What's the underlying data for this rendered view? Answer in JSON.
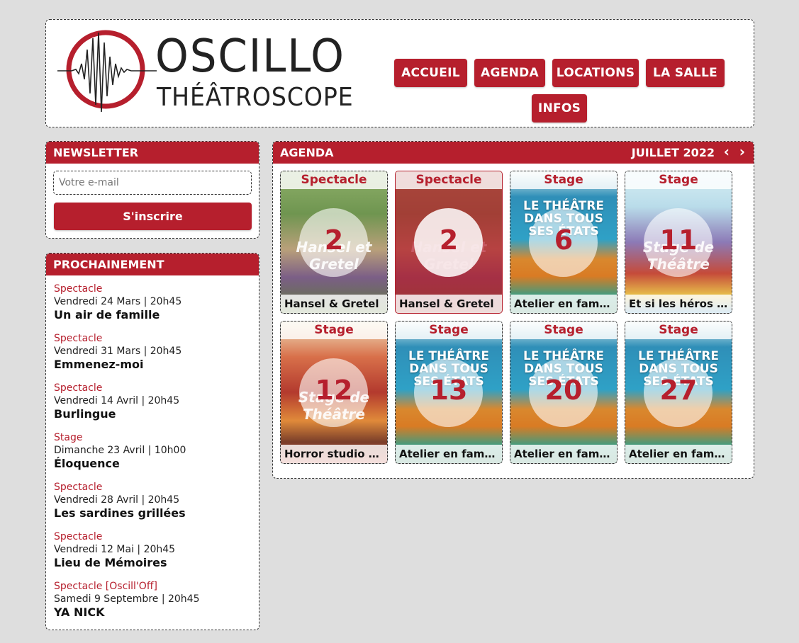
{
  "brand": {
    "line1": "OSCILLO",
    "line2": "THÉÂTROSCOPE"
  },
  "nav": [
    "ACCUEIL",
    "AGENDA",
    "LOCATIONS",
    "LA SALLE",
    "INFOS"
  ],
  "newsletter": {
    "heading": "NEWSLETTER",
    "email_placeholder": "Votre e-mail",
    "submit_label": "S'inscrire"
  },
  "upcoming": {
    "heading": "PROCHAINEMENT",
    "items": [
      {
        "type": "Spectacle",
        "date": "Vendredi 24 Mars | 20h45",
        "title": "Un air de famille"
      },
      {
        "type": "Spectacle",
        "date": "Vendredi 31 Mars | 20h45",
        "title": "Emmenez-moi"
      },
      {
        "type": "Spectacle",
        "date": "Vendredi 14 Avril | 20h45",
        "title": "Burlingue"
      },
      {
        "type": "Stage",
        "date": "Dimanche 23 Avril | 10h00",
        "title": "Éloquence"
      },
      {
        "type": "Spectacle",
        "date": "Vendredi 28 Avril | 20h45",
        "title": "Les sardines grillées"
      },
      {
        "type": "Spectacle",
        "date": "Vendredi 12 Mai | 20h45",
        "title": "Lieu de Mémoires"
      },
      {
        "type": "Spectacle [Oscill'Off]",
        "date": "Samedi 9 Septembre | 20h45",
        "title": "YA NICK"
      }
    ]
  },
  "agenda": {
    "heading": "AGENDA",
    "month": "JUILLET 2022",
    "prev_icon": "chevron-left-icon",
    "next_icon": "chevron-right-icon",
    "cards": [
      {
        "type": "Spectacle",
        "day": "2",
        "title": "Hansel & Gretel",
        "poster": "photo",
        "poster_text": [
          "Hansel et",
          "Gretel"
        ],
        "active": false
      },
      {
        "type": "Spectacle",
        "day": "2",
        "title": "Hansel & Gretel",
        "poster": "photo",
        "poster_text": [
          "Hansel et",
          "Gretel"
        ],
        "active": true
      },
      {
        "type": "Stage",
        "day": "6",
        "title": "Atelier en famille : Le théâtre dans tous ses états",
        "poster": "nature",
        "poster_text": [
          "LE THÉÂTRE",
          "DANS TOUS SES ÉTATS"
        ],
        "active": false
      },
      {
        "type": "Stage",
        "day": "11",
        "title": "Et si les héros des contes vivaient aujourd'hui ?",
        "poster": "illustration",
        "poster_text": [
          "Stage de",
          "Théâtre"
        ],
        "active": false
      },
      {
        "type": "Stage",
        "day": "12",
        "title": "Horror studio ! Mangas et autres animés",
        "poster": "manga",
        "poster_text": [
          "Stage de",
          "Théâtre"
        ],
        "active": false
      },
      {
        "type": "Stage",
        "day": "13",
        "title": "Atelier en famille : Le théâtre dans tous ses états",
        "poster": "nature",
        "poster_text": [
          "LE THÉÂTRE",
          "DANS TOUS SES ÉTATS"
        ],
        "active": false
      },
      {
        "type": "Stage",
        "day": "20",
        "title": "Atelier en famille : Le théâtre dans tous ses états",
        "poster": "nature",
        "poster_text": [
          "LE THÉÂTRE",
          "DANS TOUS SES ÉTATS"
        ],
        "active": false
      },
      {
        "type": "Stage",
        "day": "27",
        "title": "Atelier en famille : Le théâtre dans tous ses états",
        "poster": "nature",
        "poster_text": [
          "LE THÉÂTRE",
          "DANS TOUS SES ÉTATS"
        ],
        "active": false
      }
    ]
  },
  "colors": {
    "accent": "#b61f2d",
    "background": "#dedede",
    "panel": "#ffffff"
  }
}
